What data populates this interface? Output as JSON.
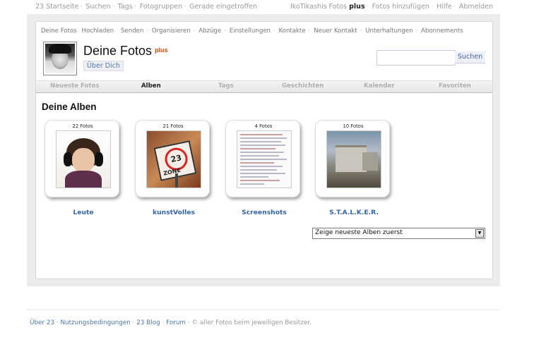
{
  "topbar": {
    "left": [
      "23 Startseite",
      "Suchen",
      "Tags",
      "Fotogruppen",
      "Gerade eingetroffen"
    ],
    "right_user": "IkoTikashis Fotos",
    "right_plus": "plus",
    "right_items": [
      "Fotos hinzufügen",
      "Hilfe",
      "Abmelden"
    ]
  },
  "subnav": [
    "Deine Fotos",
    "Hochladen",
    "Senden",
    "Organisieren",
    "Abzüge",
    "Einstellungen",
    "Kontakte",
    "Neuer Kontakt",
    "Unterhaltungen",
    "Abonnements"
  ],
  "header": {
    "title": "Deine Fotos",
    "plus": "plus",
    "about_button": "Über Dich"
  },
  "search": {
    "button": "Suchen",
    "value": ""
  },
  "tabs": [
    "Neueste Fotos",
    "Alben",
    "Tags",
    "Geschichten",
    "Kalender",
    "Favoriten"
  ],
  "active_tab": "Alben",
  "section_title": "Deine Alben",
  "albums": [
    {
      "count": "22 Fotos",
      "name": "Leute"
    },
    {
      "count": "21 Fotos",
      "name": "kunstVolles"
    },
    {
      "count": "4 Fotos",
      "name": "Screenshots"
    },
    {
      "count": "10 Fotos",
      "name": "S.T.A.L.K.E.R."
    }
  ],
  "thumb_text": {
    "sign_number": "23",
    "sign_word": "ZONE"
  },
  "sort_select": {
    "selected": "Zeige neueste Alben zuerst"
  },
  "footer": {
    "links": [
      "Über 23",
      "Nutzungsbedingungen",
      "23 Blog",
      "Forum"
    ],
    "copyright": "© aller Fotos beim jeweiligen Besitzer."
  },
  "colors": {
    "link": "#3366aa",
    "plus": "#d64a00",
    "panel": "#ececec"
  }
}
